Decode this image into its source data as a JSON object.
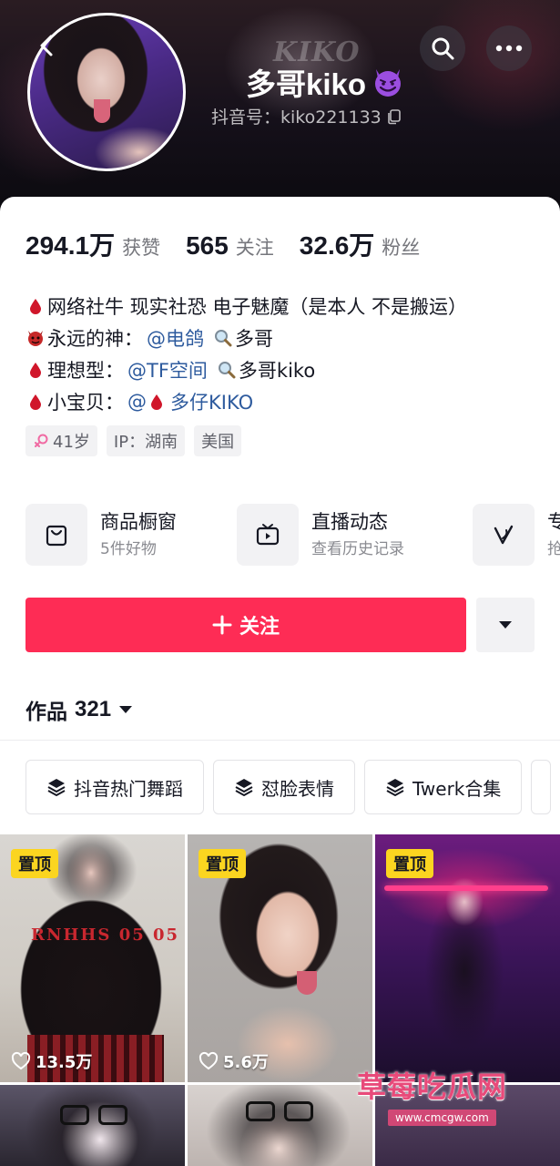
{
  "header": {
    "banner_text": "KIKO",
    "nickname": "多哥kiko",
    "nickname_emoji": "smiling-face-with-horns-emoji",
    "douyin_id": "抖音号：kiko221133"
  },
  "stats": [
    {
      "value": "294.1万",
      "label": "获赞"
    },
    {
      "value": "565",
      "label": "关注"
    },
    {
      "value": "32.6万",
      "label": "粉丝"
    }
  ],
  "bio": {
    "line1": "网络社牛 现实社恐 电子魅魔（是本人 不是搬运）",
    "line2_prefix": "永远的神：",
    "line2_link": "@电鸽",
    "line2_suffix": "多哥",
    "line3_prefix": "理想型：",
    "line3_link": "@TF空间",
    "line3_suffix": "多哥kiko",
    "line4_prefix": "小宝贝：",
    "line4_link_at": "@",
    "line4_link": "多仔KIKO"
  },
  "tags": {
    "age": "41岁",
    "ip": "IP：湖南",
    "location": "美国"
  },
  "services": [
    {
      "title": "商品橱窗",
      "subtitle": "5件好物",
      "icon": "shopping-bag-icon"
    },
    {
      "title": "直播动态",
      "subtitle": "查看历史记录",
      "icon": "tv-icon"
    },
    {
      "title": "专",
      "subtitle": "抢",
      "icon": "v-check-icon"
    }
  ],
  "actions": {
    "follow_label": "关注",
    "accent": "#fe2c55"
  },
  "works": {
    "title": "作品",
    "count": "321"
  },
  "collections": [
    "抖音热门舞蹈",
    "怼脸表情",
    "Twerk合集"
  ],
  "videos": [
    {
      "pinned_label": "置顶",
      "likes": "13.5万",
      "print": "RNHHS 05 05"
    },
    {
      "pinned_label": "置顶",
      "likes": "5.6万"
    },
    {
      "pinned_label": "置顶",
      "likes": ""
    }
  ],
  "watermark": {
    "name": "草莓吃瓜网",
    "url": "www.cmcgw.com"
  }
}
